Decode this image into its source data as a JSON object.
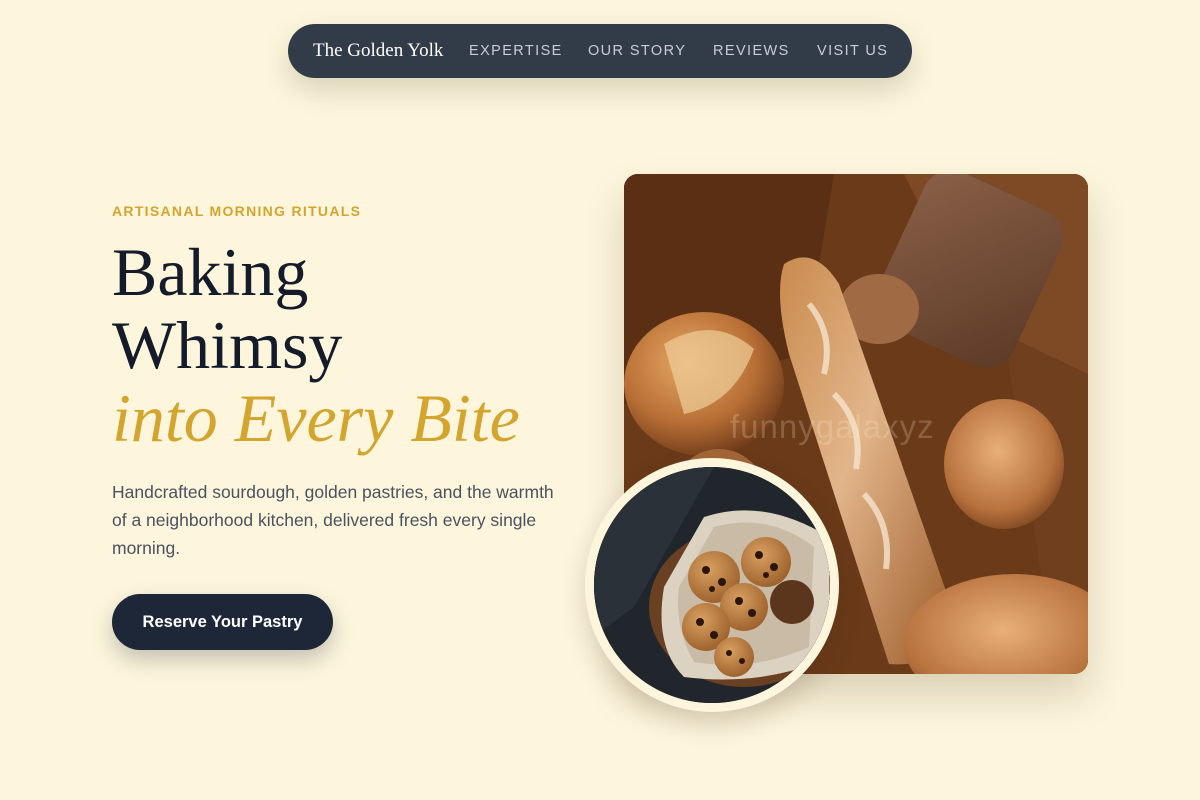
{
  "nav": {
    "brand": "The Golden Yolk",
    "links": [
      "EXPERTISE",
      "OUR STORY",
      "REVIEWS",
      "VISIT US"
    ]
  },
  "hero": {
    "eyebrow": "ARTISANAL MORNING RITUALS",
    "headline_line1": "Baking",
    "headline_line2": "Whimsy",
    "headline_accent": "into Every Bite",
    "description": "Handcrafted sourdough, golden pastries, and the warmth of a neighborhood kitchen, delivered fresh every single morning.",
    "cta_label": "Reserve Your Pastry"
  },
  "images": {
    "main": "bread-basket-photo",
    "inset": "cookies-bowl-photo"
  },
  "watermark": "funnygalaxyz",
  "colors": {
    "background": "#fdf6dc",
    "nav_bg": "#323c49",
    "accent_gold": "#d3a52e",
    "heading": "#141c2b",
    "cta_bg": "#1e2738"
  }
}
